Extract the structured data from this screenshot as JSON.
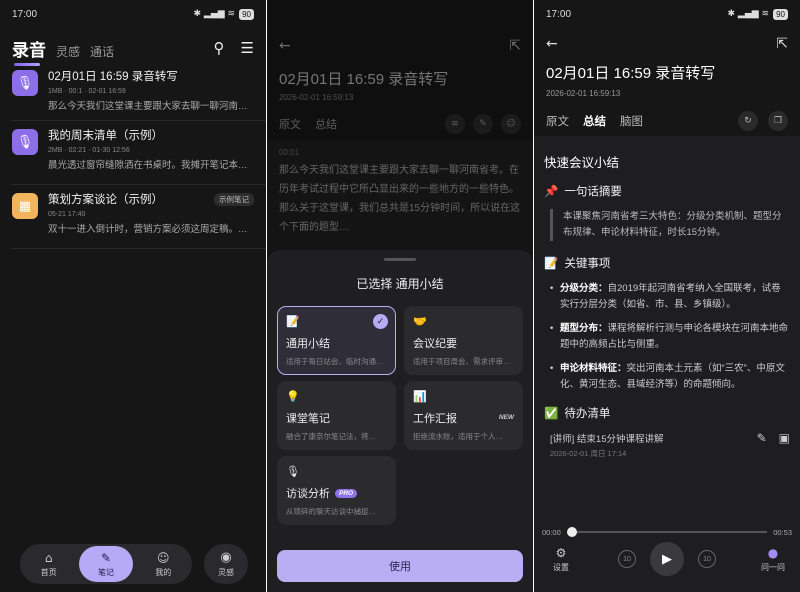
{
  "status": {
    "time": "17:00",
    "battery": "90"
  },
  "screen1": {
    "tabs": [
      "录音",
      "灵感",
      "通话"
    ],
    "notes": [
      {
        "title": "02月01日 16:59 录音转写",
        "meta": "1MB · 00:1 · 02-01 16:59",
        "preview": "那么今天我们这堂课主要跟大家去聊一聊河南…",
        "icon": "mic-icon",
        "badge": ""
      },
      {
        "title": "我的周末清单（示例）",
        "meta": "2MB · 02:21 · 01-30 12:56",
        "preview": "晨光透过窗帘缝隙洒在书桌时。我摊开笔记本…",
        "icon": "mic-icon",
        "badge": ""
      },
      {
        "title": "策划方案谈论（示例）",
        "meta": "05-21 17:40",
        "preview": "双十一进入倒计时，营销方案必须这周定稿。…",
        "icon": "doc-icon",
        "badge": "示例笔记"
      }
    ],
    "nav": {
      "home": "首页",
      "notes": "笔记",
      "mine": "我的",
      "inspire": "灵感"
    }
  },
  "screen2": {
    "title": "02月01日 16:59 录音转写",
    "time": "2026-02-01 16:59:13",
    "tabs": [
      "原文",
      "总结"
    ],
    "timestamp": "00:01",
    "transcript": "那么今天我们这堂课主要跟大家去聊一聊河南省考。在历年考试过程中它所凸显出来的一些地方的一些特色。那么关于这堂课，我们总共是15分钟时间，所以说在这个下面的题型…",
    "sheet_title": "已选择 通用小结",
    "templates": [
      {
        "name": "通用小结",
        "desc": "适用于每日站会、临时沟通…",
        "icon": "📝",
        "badge": ""
      },
      {
        "name": "会议纪要",
        "desc": "适用于项目周会、需求评审…",
        "icon": "🤝",
        "badge": ""
      },
      {
        "name": "课堂笔记",
        "desc": "融合了康奈尔笔记法，将…",
        "icon": "💡",
        "badge": ""
      },
      {
        "name": "工作汇报",
        "desc": "拒绝流水账，适用于个人…",
        "icon": "📊",
        "badge": "NEW"
      },
      {
        "name": "访谈分析",
        "desc": "从琐碎的聊天访谈中捕捉…",
        "icon": "🎙",
        "badge": "PRO"
      }
    ],
    "use_button": "使用"
  },
  "screen3": {
    "title": "02月01日 16:59 录音转写",
    "time": "2026-02-01 16:59:13",
    "tabs": [
      "原文",
      "总结",
      "脑图"
    ],
    "summary_title": "快速会议小结",
    "sec1": "一句话摘要",
    "quote": "本课聚焦河南省考三大特色：分级分类机制、题型分布规律、申论材料特征，时长15分钟。",
    "sec2": "关键事项",
    "bullets": [
      {
        "k": "分级分类：",
        "v": "自2019年起河南省考纳入全国联考，试卷实行分层分类（如省、市、县、乡镇级）。"
      },
      {
        "k": "题型分布：",
        "v": "课程将解析行测与申论各模块在河南本地命题中的高频占比与侧重。"
      },
      {
        "k": "申论材料特征：",
        "v": "突出河南本土元素（如“三农”、中原文化、黄河生态、县域经济等）的命题倾向。"
      }
    ],
    "sec3": "待办清单",
    "todo": "[讲师] 结束15分钟课程讲解",
    "todo_time": "2026-02-01 周日 17:14",
    "player": {
      "start": "00:00",
      "end": "00:53",
      "skip_back": "10",
      "skip_fwd": "10",
      "settings": "设置",
      "ask": "问一问"
    }
  }
}
